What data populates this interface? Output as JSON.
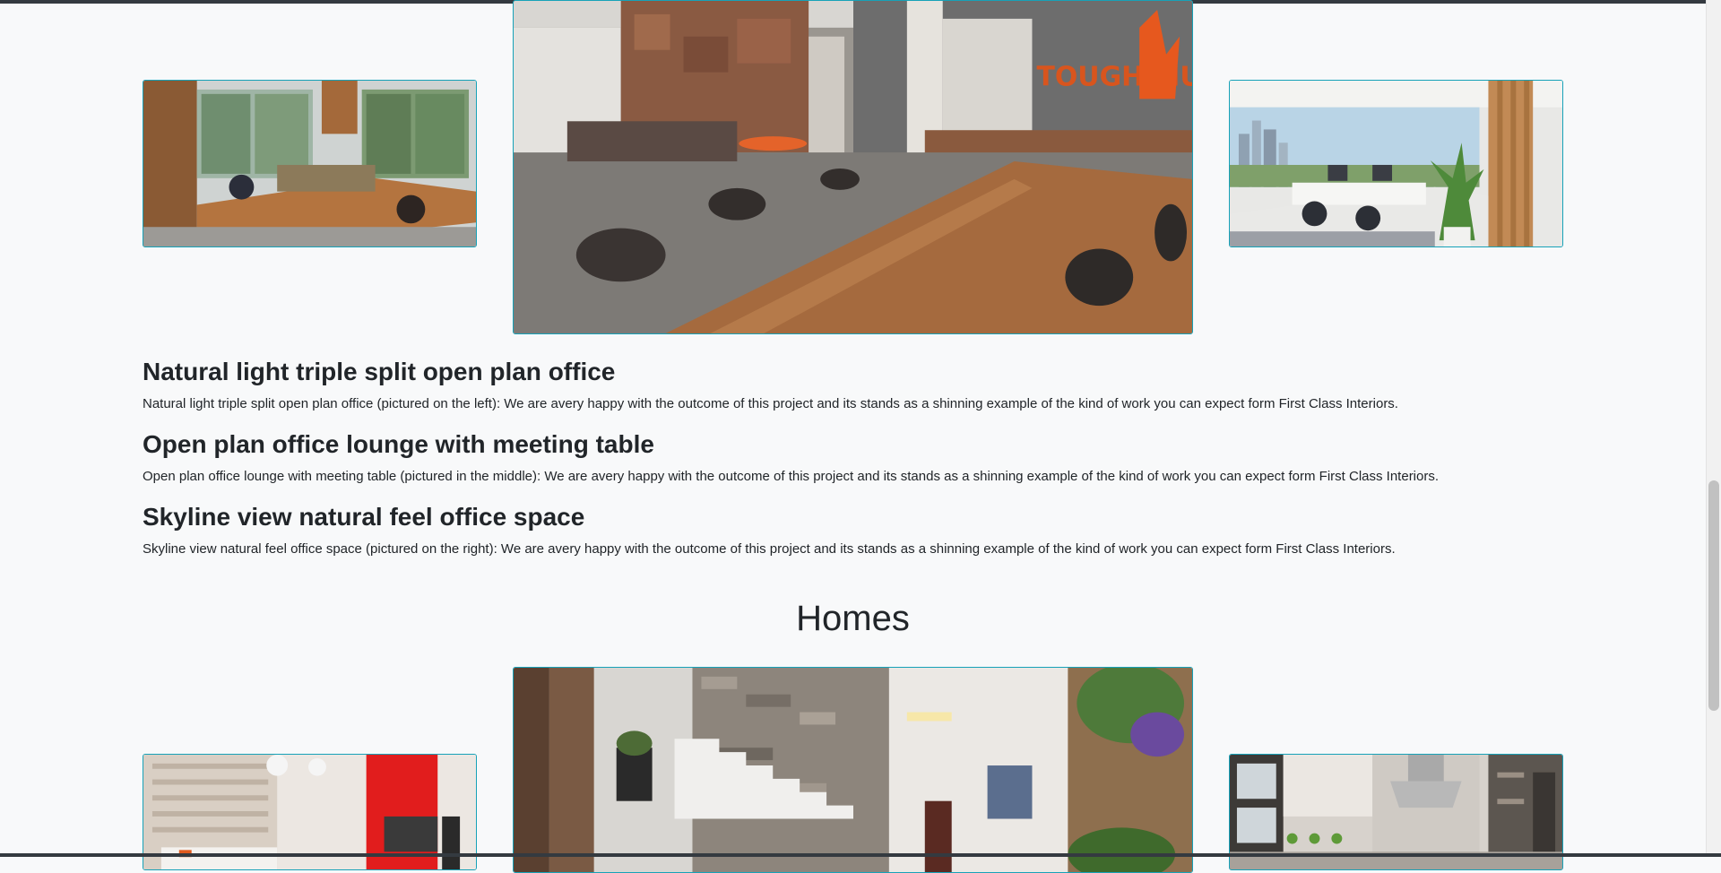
{
  "offices": {
    "items": [
      {
        "title": "Natural light triple split open plan office",
        "description": "Natural light triple split open plan office (pictured on the left): We are avery happy with the outcome of this project and its stands as a shinning example of the kind of work you can expect form First Class Interiors."
      },
      {
        "title": "Open plan office lounge with meeting table",
        "description": "Open plan office lounge with meeting table (pictured in the middle): We are avery happy with the outcome of this project and its stands as a shinning example of the kind of work you can expect form First Class Interiors."
      },
      {
        "title": "Skyline view natural feel office space",
        "description": "Skyline view natural feel office space (pictured on the right): We are avery happy with the outcome of this project and its stands as a shinning example of the kind of work you can expect form First Class Interiors."
      }
    ],
    "sign_text": "TOUGH MUDDER"
  },
  "homes": {
    "heading": "Homes"
  },
  "colors": {
    "frame_border": "#17a2b8",
    "background": "#f8f9fa",
    "text": "#212529"
  }
}
